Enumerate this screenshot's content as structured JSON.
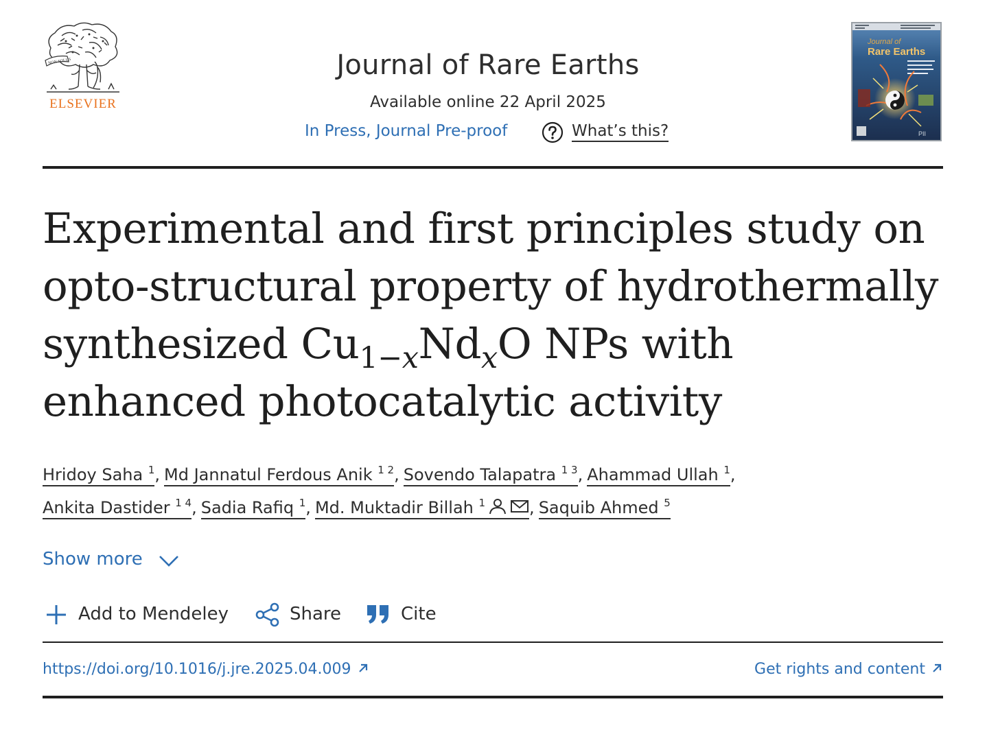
{
  "header": {
    "publisher": "ELSEVIER",
    "journal_title": "Journal of Rare Earths",
    "available_online": "Available online 22 April 2025",
    "status": "In Press, Journal Pre-proof",
    "whats_this": "What’s this?",
    "cover": {
      "title_line1": "Journal of",
      "title_line2": "Rare Earths"
    }
  },
  "article": {
    "title_part1": "Experimental and first principles study on opto-structural property of hydrothermally synthesized Cu",
    "sub1": "1−",
    "sub1_var": "x",
    "title_part2": "Nd",
    "sub2_var": "x",
    "title_part3": "O NPs with enhanced photocatalytic activity"
  },
  "authors": [
    {
      "name": "Hridoy Saha",
      "aff": "1"
    },
    {
      "name": "Md Jannatul Ferdous Anik",
      "aff": "1 2"
    },
    {
      "name": "Sovendo Talapatra",
      "aff": "1 3"
    },
    {
      "name": "Ahammad Ullah",
      "aff": "1"
    },
    {
      "name": "Ankita Dastider",
      "aff": "1 4"
    },
    {
      "name": "Sadia Rafiq",
      "aff": "1"
    },
    {
      "name": "Md. Muktadir Billah",
      "aff": "1"
    },
    {
      "name": "Saquib Ahmed",
      "aff": "5"
    }
  ],
  "show_more": "Show more",
  "actions": {
    "mendeley": "Add to Mendeley",
    "share": "Share",
    "cite": "Cite"
  },
  "links": {
    "doi": "https://doi.org/10.1016/j.jre.2025.04.009",
    "rights": "Get rights and content"
  },
  "colors": {
    "link_blue": "#2e6fb4",
    "elsevier_orange": "#e9711c",
    "text": "#2e2e2e"
  }
}
